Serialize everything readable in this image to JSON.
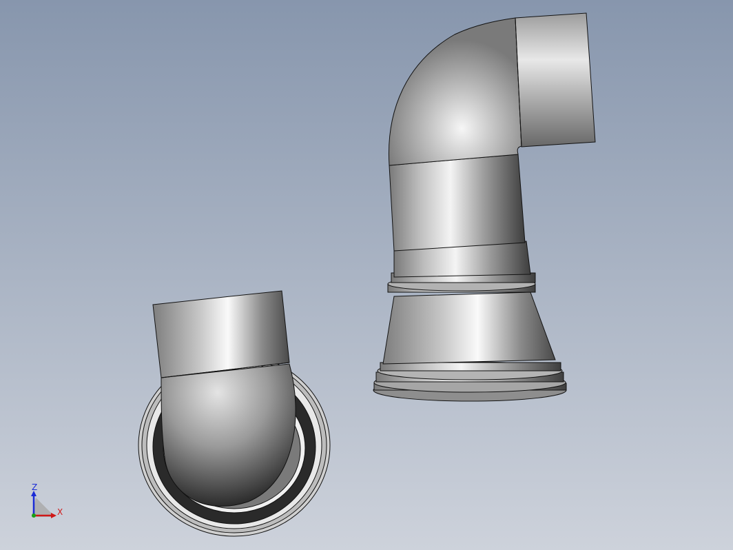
{
  "viewport": {
    "background_top": "#8796ad",
    "background_bottom": "#cdd2db"
  },
  "triad": {
    "z_label": "Z",
    "x_label": "X",
    "z_color": "#1a2bd6",
    "x_color": "#d01818",
    "y_color": "#18a018"
  },
  "parts": [
    {
      "name": "elbow-pipe-assembly-upright",
      "color": "#a8a8a8"
    },
    {
      "name": "elbow-pipe-assembly-top-view",
      "color": "#a8a8a8"
    }
  ]
}
